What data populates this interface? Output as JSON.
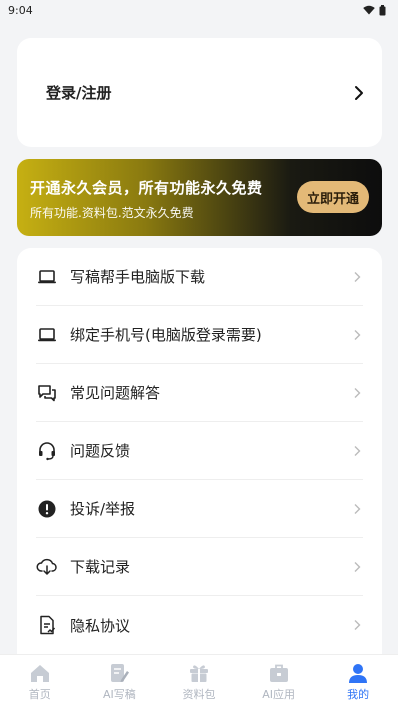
{
  "status": {
    "time": "9:04"
  },
  "login": {
    "label": "登录/注册"
  },
  "vip": {
    "title": "开通永久会员，所有功能永久免费",
    "subtitle": "所有功能.资料包.范文永久免费",
    "button": "立即开通"
  },
  "menu": {
    "items": [
      {
        "label": "写稿帮手电脑版下载",
        "icon": "laptop-icon"
      },
      {
        "label": "绑定手机号(电脑版登录需要)",
        "icon": "laptop-icon"
      },
      {
        "label": "常见问题解答",
        "icon": "chat-bubbles-icon"
      },
      {
        "label": "问题反馈",
        "icon": "headset-icon"
      },
      {
        "label": "投诉/举报",
        "icon": "alert-icon"
      },
      {
        "label": "下载记录",
        "icon": "cloud-download-icon"
      },
      {
        "label": "隐私协议",
        "icon": "document-icon"
      }
    ]
  },
  "tabs": [
    {
      "label": "首页",
      "icon": "home-icon",
      "active": false
    },
    {
      "label": "AI写稿",
      "icon": "pen-doc-icon",
      "active": false
    },
    {
      "label": "资料包",
      "icon": "gift-icon",
      "active": false
    },
    {
      "label": "AI应用",
      "icon": "toolbox-icon",
      "active": false
    },
    {
      "label": "我的",
      "icon": "user-icon",
      "active": true
    }
  ],
  "colors": {
    "accent": "#2f74f6",
    "vip_button": "#e3b977",
    "tab_inactive": "#b0b6c0"
  }
}
